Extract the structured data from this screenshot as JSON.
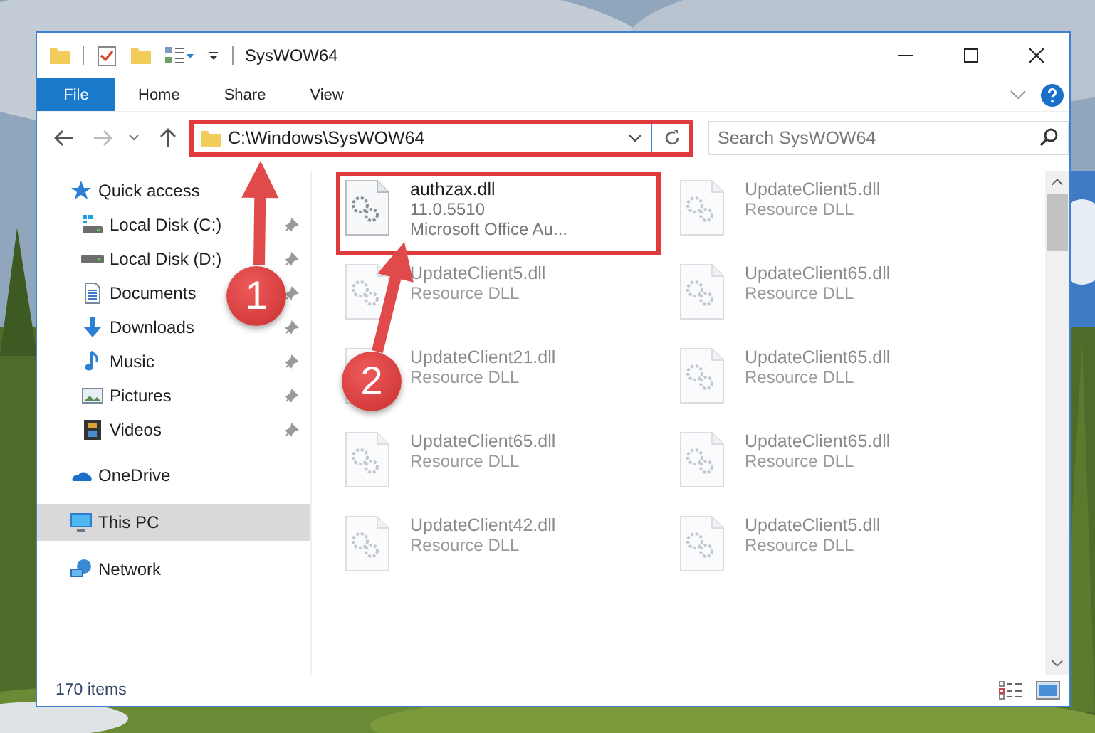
{
  "window": {
    "title": "SysWOW64"
  },
  "ribbon_tabs": [
    {
      "label": "File",
      "kind": "file"
    },
    {
      "label": "Home",
      "kind": "tab"
    },
    {
      "label": "Share",
      "kind": "tab"
    },
    {
      "label": "View",
      "kind": "tab"
    }
  ],
  "address_bar": {
    "path": "C:\\Windows\\SysWOW64",
    "highlighted": true
  },
  "search": {
    "placeholder": "Search SysWOW64"
  },
  "navigation": [
    {
      "label": "Quick access",
      "kind": "star",
      "selected": false,
      "children": [
        {
          "label": "Local Disk (C:)",
          "kind": "systemdrive",
          "pinned": true,
          "selected": false
        },
        {
          "label": "Local Disk (D:)",
          "kind": "drive",
          "pinned": true,
          "selected": false
        },
        {
          "label": "Documents",
          "kind": "document",
          "pinned": true,
          "selected": false
        },
        {
          "label": "Downloads",
          "kind": "download",
          "pinned": true,
          "selected": false
        },
        {
          "label": "Music",
          "kind": "music",
          "pinned": true,
          "selected": false
        },
        {
          "label": "Pictures",
          "kind": "pictures",
          "pinned": true,
          "selected": false
        },
        {
          "label": "Videos",
          "kind": "videos",
          "pinned": true,
          "selected": false
        }
      ]
    },
    {
      "label": "OneDrive",
      "kind": "cloud",
      "selected": false
    },
    {
      "label": "This PC",
      "kind": "computer",
      "selected": true
    },
    {
      "label": "Network",
      "kind": "network",
      "selected": false
    }
  ],
  "files": [
    {
      "name": "authzax.dll",
      "details": [
        "11.0.5510",
        "Microsoft Office Au..."
      ],
      "highlighted": true,
      "blurred": false
    },
    {
      "name": "UpdateClient5.dll",
      "details": [
        "Resource DLL"
      ],
      "highlighted": false,
      "blurred": true
    },
    {
      "name": "UpdateClient5.dll",
      "details": [
        "Resource DLL"
      ],
      "highlighted": false,
      "blurred": true
    },
    {
      "name": "UpdateClient65.dll",
      "details": [
        "Resource DLL"
      ],
      "highlighted": false,
      "blurred": true
    },
    {
      "name": "UpdateClient21.dll",
      "details": [
        "Resource DLL"
      ],
      "highlighted": false,
      "blurred": true
    },
    {
      "name": "UpdateClient65.dll",
      "details": [
        "Resource DLL"
      ],
      "highlighted": false,
      "blurred": true
    },
    {
      "name": "UpdateClient65.dll",
      "details": [
        "Resource DLL"
      ],
      "highlighted": false,
      "blurred": true
    },
    {
      "name": "UpdateClient65.dll",
      "details": [
        "Resource DLL"
      ],
      "highlighted": false,
      "blurred": true
    },
    {
      "name": "UpdateClient42.dll",
      "details": [
        "Resource DLL"
      ],
      "highlighted": false,
      "blurred": true
    },
    {
      "name": "UpdateClient5.dll",
      "details": [
        "Resource DLL"
      ],
      "highlighted": false,
      "blurred": true
    }
  ],
  "status_bar": {
    "item_count": "170 items"
  },
  "annotations": [
    {
      "label": "1"
    },
    {
      "label": "2"
    }
  ]
}
